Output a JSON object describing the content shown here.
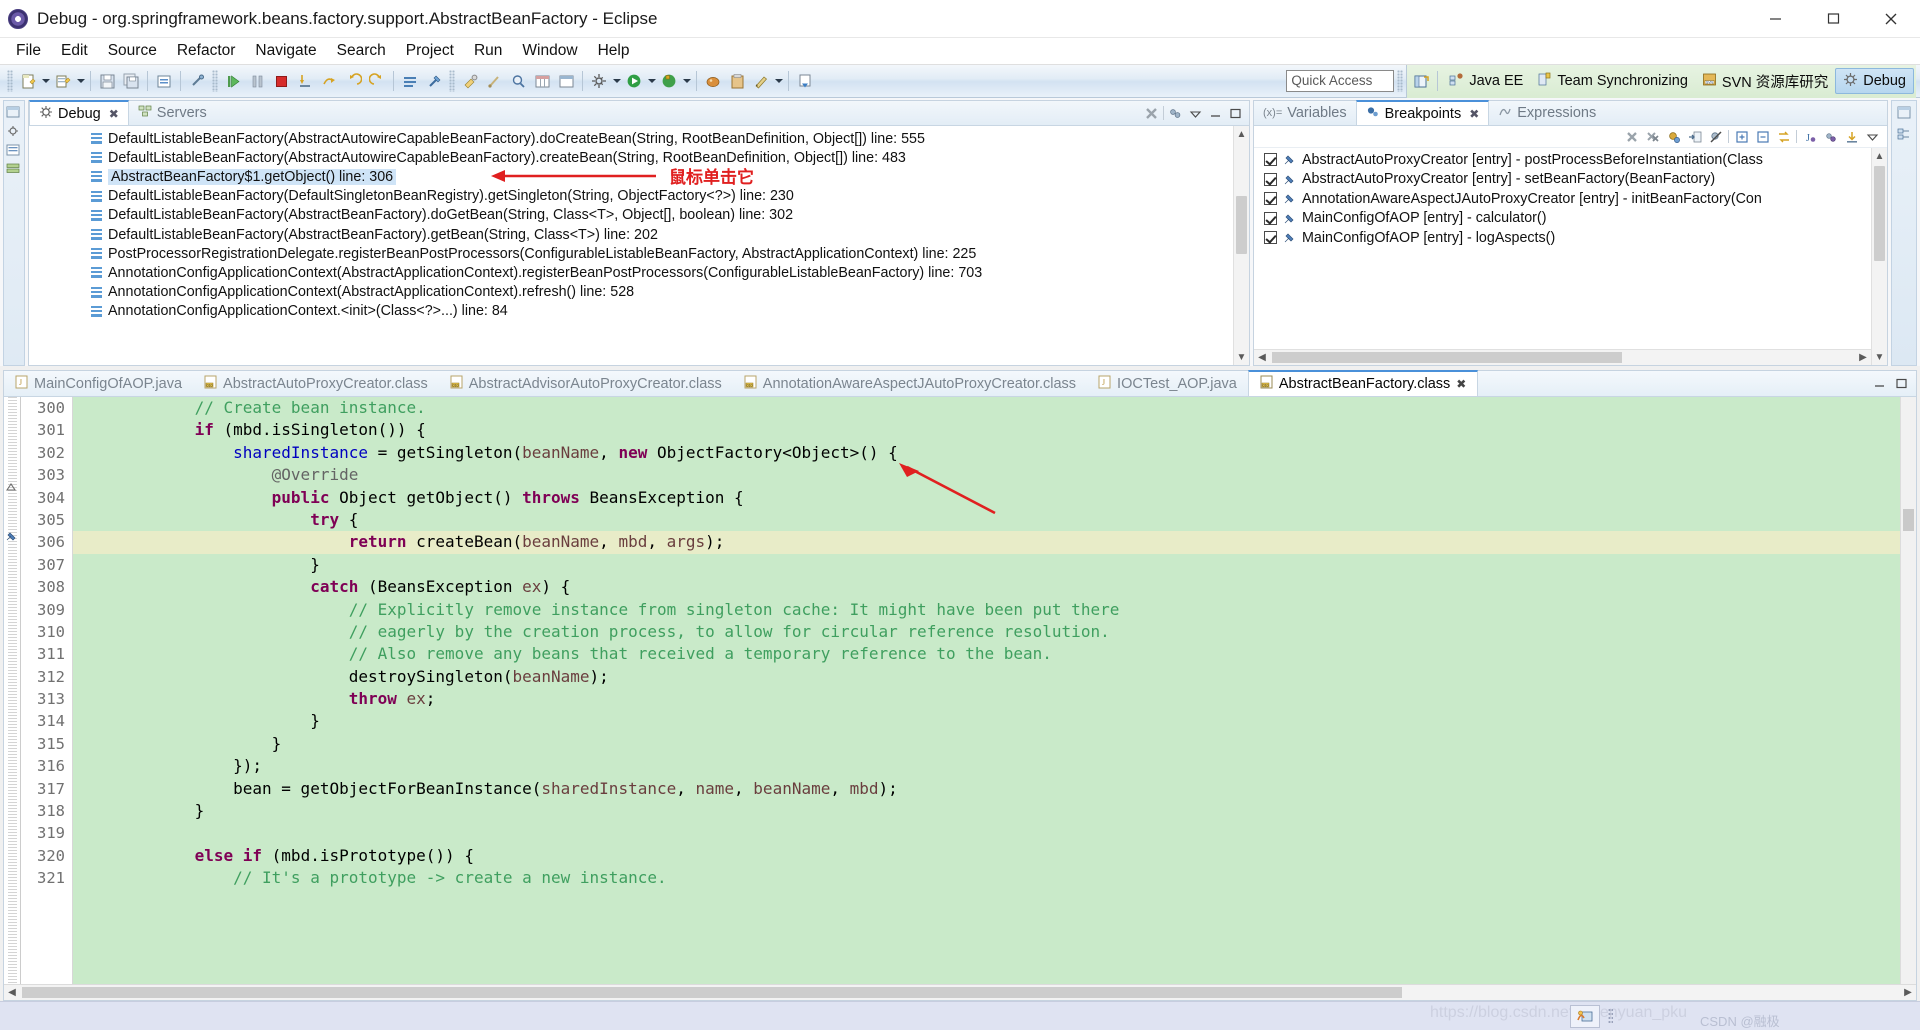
{
  "window": {
    "title": "Debug - org.springframework.beans.factory.support.AbstractBeanFactory - Eclipse",
    "app_icon": "eclipse-icon",
    "minimize": "minimize-button",
    "maximize": "maximize-button",
    "close": "close-button"
  },
  "menubar": {
    "items": [
      "File",
      "Edit",
      "Source",
      "Refactor",
      "Navigate",
      "Search",
      "Project",
      "Run",
      "Window",
      "Help"
    ]
  },
  "toolbar": {
    "quick_access_placeholder": "Quick Access",
    "quick_access_value": ""
  },
  "perspectives": {
    "open_perspective_icon": "open-perspective-icon",
    "items": [
      {
        "label": "Java EE",
        "icon": "java-ee-icon",
        "active": false
      },
      {
        "label": "Team Synchronizing",
        "icon": "team-sync-icon",
        "active": false
      },
      {
        "label": "SVN 资源库研究",
        "icon": "svn-icon",
        "active": false
      },
      {
        "label": "Debug",
        "icon": "debug-icon",
        "active": true
      }
    ]
  },
  "debug_view": {
    "tabs": [
      {
        "label": "Debug",
        "icon": "debug-icon",
        "active": true,
        "closable": true
      },
      {
        "label": "Servers",
        "icon": "servers-icon",
        "active": false,
        "closable": false
      }
    ],
    "toolbar_icons": [
      "terminate-all-icon",
      "thread-filter-icon",
      "view-menu-icon",
      "minimize-icon",
      "maximize-icon"
    ],
    "stack_frames": [
      {
        "text": "DefaultListableBeanFactory(AbstractAutowireCapableBeanFactory).doCreateBean(String, RootBeanDefinition, Object[]) line: 555",
        "selected": false
      },
      {
        "text": "DefaultListableBeanFactory(AbstractAutowireCapableBeanFactory).createBean(String, RootBeanDefinition, Object[]) line: 483",
        "selected": false
      },
      {
        "text": "AbstractBeanFactory$1.getObject() line: 306",
        "selected": true
      },
      {
        "text": "DefaultListableBeanFactory(DefaultSingletonBeanRegistry).getSingleton(String, ObjectFactory<?>) line: 230",
        "selected": false
      },
      {
        "text": "DefaultListableBeanFactory(AbstractBeanFactory).doGetBean(String, Class<T>, Object[], boolean) line: 302",
        "selected": false
      },
      {
        "text": "DefaultListableBeanFactory(AbstractBeanFactory).getBean(String, Class<T>) line: 202",
        "selected": false
      },
      {
        "text": "PostProcessorRegistrationDelegate.registerBeanPostProcessors(ConfigurableListableBeanFactory, AbstractApplicationContext) line: 225",
        "selected": false
      },
      {
        "text": "AnnotationConfigApplicationContext(AbstractApplicationContext).registerBeanPostProcessors(ConfigurableListableBeanFactory) line: 703",
        "selected": false
      },
      {
        "text": "AnnotationConfigApplicationContext(AbstractApplicationContext).refresh() line: 528",
        "selected": false
      },
      {
        "text": "AnnotationConfigApplicationContext.<init>(Class<?>...) line: 84",
        "selected": false
      }
    ],
    "annotation": "鼠标单击它"
  },
  "breakpoints_view": {
    "tabs": [
      {
        "label": "Variables",
        "icon": "variables-icon",
        "active": false,
        "closable": false
      },
      {
        "label": "Breakpoints",
        "icon": "breakpoints-icon",
        "active": true,
        "closable": true
      },
      {
        "label": "Expressions",
        "icon": "expressions-icon",
        "active": false,
        "closable": false
      }
    ],
    "toolbar_icons": [
      "remove-breakpoint-icon",
      "remove-all-breakpoints-icon",
      "breakpoint-properties-icon",
      "goto-file-icon",
      "skip-all-breakpoints-icon",
      "expand-all-icon",
      "collapse-all-icon",
      "link-with-debug-view-icon",
      "add-java-exception-icon",
      "working-sets-icon",
      "import-icon",
      "view-menu-icon"
    ],
    "items": [
      {
        "checked": true,
        "text": "AbstractAutoProxyCreator [entry] - postProcessBeforeInstantiation(Class"
      },
      {
        "checked": true,
        "text": "AbstractAutoProxyCreator [entry] - setBeanFactory(BeanFactory)"
      },
      {
        "checked": true,
        "text": "AnnotationAwareAspectJAutoProxyCreator [entry] - initBeanFactory(Con"
      },
      {
        "checked": true,
        "text": "MainConfigOfAOP [entry] - calculator()"
      },
      {
        "checked": true,
        "text": "MainConfigOfAOP [entry] - logAspects()"
      }
    ]
  },
  "editor": {
    "tabs": [
      {
        "label": "MainConfigOfAOP.java",
        "icon": "java-file-icon",
        "active": false,
        "closable": false
      },
      {
        "label": "AbstractAutoProxyCreator.class",
        "icon": "class-file-icon",
        "active": false,
        "closable": false
      },
      {
        "label": "AbstractAdvisorAutoProxyCreator.class",
        "icon": "class-file-icon",
        "active": false,
        "closable": false
      },
      {
        "label": "AnnotationAwareAspectJAutoProxyCreator.class",
        "icon": "class-file-icon",
        "active": false,
        "closable": false
      },
      {
        "label": "IOCTest_AOP.java",
        "icon": "java-file-icon",
        "active": false,
        "closable": false
      },
      {
        "label": "AbstractBeanFactory.class",
        "icon": "class-file-icon",
        "active": true,
        "closable": true
      }
    ],
    "first_line_number": 300,
    "lines": [
      {
        "n": 300,
        "highlight": "none",
        "tokens": [
          {
            "t": "            ",
            "c": "pl"
          },
          {
            "t": "// Create bean instance.",
            "c": "cm"
          }
        ]
      },
      {
        "n": 301,
        "highlight": "none",
        "tokens": [
          {
            "t": "            ",
            "c": "pl"
          },
          {
            "t": "if",
            "c": "k"
          },
          {
            "t": " (mbd.isSingleton()) {",
            "c": "pl"
          }
        ]
      },
      {
        "n": 302,
        "highlight": "none",
        "tokens": [
          {
            "t": "                ",
            "c": "pl"
          },
          {
            "t": "sharedInstance",
            "c": "fld"
          },
          {
            "t": " = getSingleton(",
            "c": "pl"
          },
          {
            "t": "beanName",
            "c": "loc"
          },
          {
            "t": ", ",
            "c": "pl"
          },
          {
            "t": "new",
            "c": "k"
          },
          {
            "t": " ObjectFactory<Object>() {",
            "c": "pl"
          }
        ]
      },
      {
        "n": 303,
        "highlight": "none",
        "tokens": [
          {
            "t": "                    ",
            "c": "pl"
          },
          {
            "t": "@Override",
            "c": "ann"
          }
        ]
      },
      {
        "n": 304,
        "highlight": "none",
        "tokens": [
          {
            "t": "                    ",
            "c": "pl"
          },
          {
            "t": "public",
            "c": "k"
          },
          {
            "t": " Object getObject() ",
            "c": "pl"
          },
          {
            "t": "throws",
            "c": "k"
          },
          {
            "t": " BeansException {",
            "c": "pl"
          }
        ]
      },
      {
        "n": 305,
        "highlight": "none",
        "tokens": [
          {
            "t": "                        ",
            "c": "pl"
          },
          {
            "t": "try",
            "c": "k"
          },
          {
            "t": " {",
            "c": "pl"
          }
        ]
      },
      {
        "n": 306,
        "highlight": "current",
        "tokens": [
          {
            "t": "                            ",
            "c": "pl"
          },
          {
            "t": "return",
            "c": "k"
          },
          {
            "t": " createBean(",
            "c": "pl"
          },
          {
            "t": "beanName",
            "c": "loc"
          },
          {
            "t": ", ",
            "c": "pl"
          },
          {
            "t": "mbd",
            "c": "loc"
          },
          {
            "t": ", ",
            "c": "pl"
          },
          {
            "t": "args",
            "c": "loc"
          },
          {
            "t": ");",
            "c": "pl"
          }
        ]
      },
      {
        "n": 307,
        "highlight": "none",
        "tokens": [
          {
            "t": "                        }",
            "c": "pl"
          }
        ]
      },
      {
        "n": 308,
        "highlight": "none",
        "tokens": [
          {
            "t": "                        ",
            "c": "pl"
          },
          {
            "t": "catch",
            "c": "k"
          },
          {
            "t": " (BeansException ",
            "c": "pl"
          },
          {
            "t": "ex",
            "c": "loc"
          },
          {
            "t": ") {",
            "c": "pl"
          }
        ]
      },
      {
        "n": 309,
        "highlight": "none",
        "tokens": [
          {
            "t": "                            ",
            "c": "pl"
          },
          {
            "t": "// Explicitly remove instance from singleton cache: It might have been put there",
            "c": "cm"
          }
        ]
      },
      {
        "n": 310,
        "highlight": "none",
        "tokens": [
          {
            "t": "                            ",
            "c": "pl"
          },
          {
            "t": "// eagerly by the creation process, to allow for circular reference resolution.",
            "c": "cm"
          }
        ]
      },
      {
        "n": 311,
        "highlight": "none",
        "tokens": [
          {
            "t": "                            ",
            "c": "pl"
          },
          {
            "t": "// Also remove any beans that received a temporary reference to the bean.",
            "c": "cm"
          }
        ]
      },
      {
        "n": 312,
        "highlight": "none",
        "tokens": [
          {
            "t": "                            destroySingleton(",
            "c": "pl"
          },
          {
            "t": "beanName",
            "c": "loc"
          },
          {
            "t": ");",
            "c": "pl"
          }
        ]
      },
      {
        "n": 313,
        "highlight": "none",
        "tokens": [
          {
            "t": "                            ",
            "c": "pl"
          },
          {
            "t": "throw",
            "c": "k"
          },
          {
            "t": " ",
            "c": "pl"
          },
          {
            "t": "ex",
            "c": "loc"
          },
          {
            "t": ";",
            "c": "pl"
          }
        ]
      },
      {
        "n": 314,
        "highlight": "none",
        "tokens": [
          {
            "t": "                        }",
            "c": "pl"
          }
        ]
      },
      {
        "n": 315,
        "highlight": "none",
        "tokens": [
          {
            "t": "                    }",
            "c": "pl"
          }
        ]
      },
      {
        "n": 316,
        "highlight": "none",
        "tokens": [
          {
            "t": "                });",
            "c": "pl"
          }
        ]
      },
      {
        "n": 317,
        "highlight": "none",
        "tokens": [
          {
            "t": "                bean = getObjectForBeanInstance(",
            "c": "pl"
          },
          {
            "t": "sharedInstance",
            "c": "loc"
          },
          {
            "t": ", ",
            "c": "pl"
          },
          {
            "t": "name",
            "c": "loc"
          },
          {
            "t": ", ",
            "c": "pl"
          },
          {
            "t": "beanName",
            "c": "loc"
          },
          {
            "t": ", ",
            "c": "pl"
          },
          {
            "t": "mbd",
            "c": "loc"
          },
          {
            "t": ");",
            "c": "pl"
          }
        ]
      },
      {
        "n": 318,
        "highlight": "none",
        "tokens": [
          {
            "t": "            }",
            "c": "pl"
          }
        ]
      },
      {
        "n": 319,
        "highlight": "none",
        "tokens": [
          {
            "t": "",
            "c": "pl"
          }
        ]
      },
      {
        "n": 320,
        "highlight": "none",
        "tokens": [
          {
            "t": "            ",
            "c": "pl"
          },
          {
            "t": "else",
            "c": "k"
          },
          {
            "t": " ",
            "c": "pl"
          },
          {
            "t": "if",
            "c": "k"
          },
          {
            "t": " (mbd.isPrototype()) {",
            "c": "pl"
          }
        ]
      },
      {
        "n": 321,
        "highlight": "none",
        "tokens": [
          {
            "t": "                ",
            "c": "pl"
          },
          {
            "t": "// It's a prototype -> create a new instance.",
            "c": "cm"
          }
        ]
      }
    ]
  },
  "statusbar": {
    "watermark": "https://blog.csdn.net/yerenyuan_pku",
    "csdn_tag": "CSDN @融极",
    "tool_icon": "writable-smart-insert-icon"
  },
  "colors": {
    "accent": "#4a90d9",
    "code_bg": "#c9eac9",
    "current_line": "#e8ecc8",
    "selection": "#cfe4f7",
    "annotation_red": "#e02020",
    "perspective_bg": "#dcecd5"
  }
}
